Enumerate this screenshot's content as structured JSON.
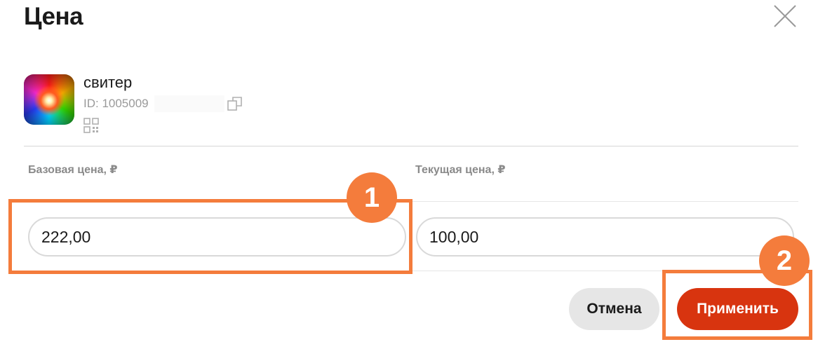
{
  "dialog": {
    "title": "Цена"
  },
  "product": {
    "name": "свитер",
    "id_label": "ID: 1005009"
  },
  "prices": {
    "base_label": "Базовая цена, ₽",
    "base_value": "222,00",
    "current_label": "Текущая цена, ₽",
    "current_value": "100,00"
  },
  "annotations": {
    "step1": "1",
    "step2": "2",
    "color": "#f47c3c"
  },
  "buttons": {
    "cancel": "Отмена",
    "apply": "Применить"
  },
  "colors": {
    "accent": "#d8340f",
    "secondary_button": "#e6e6e6"
  }
}
